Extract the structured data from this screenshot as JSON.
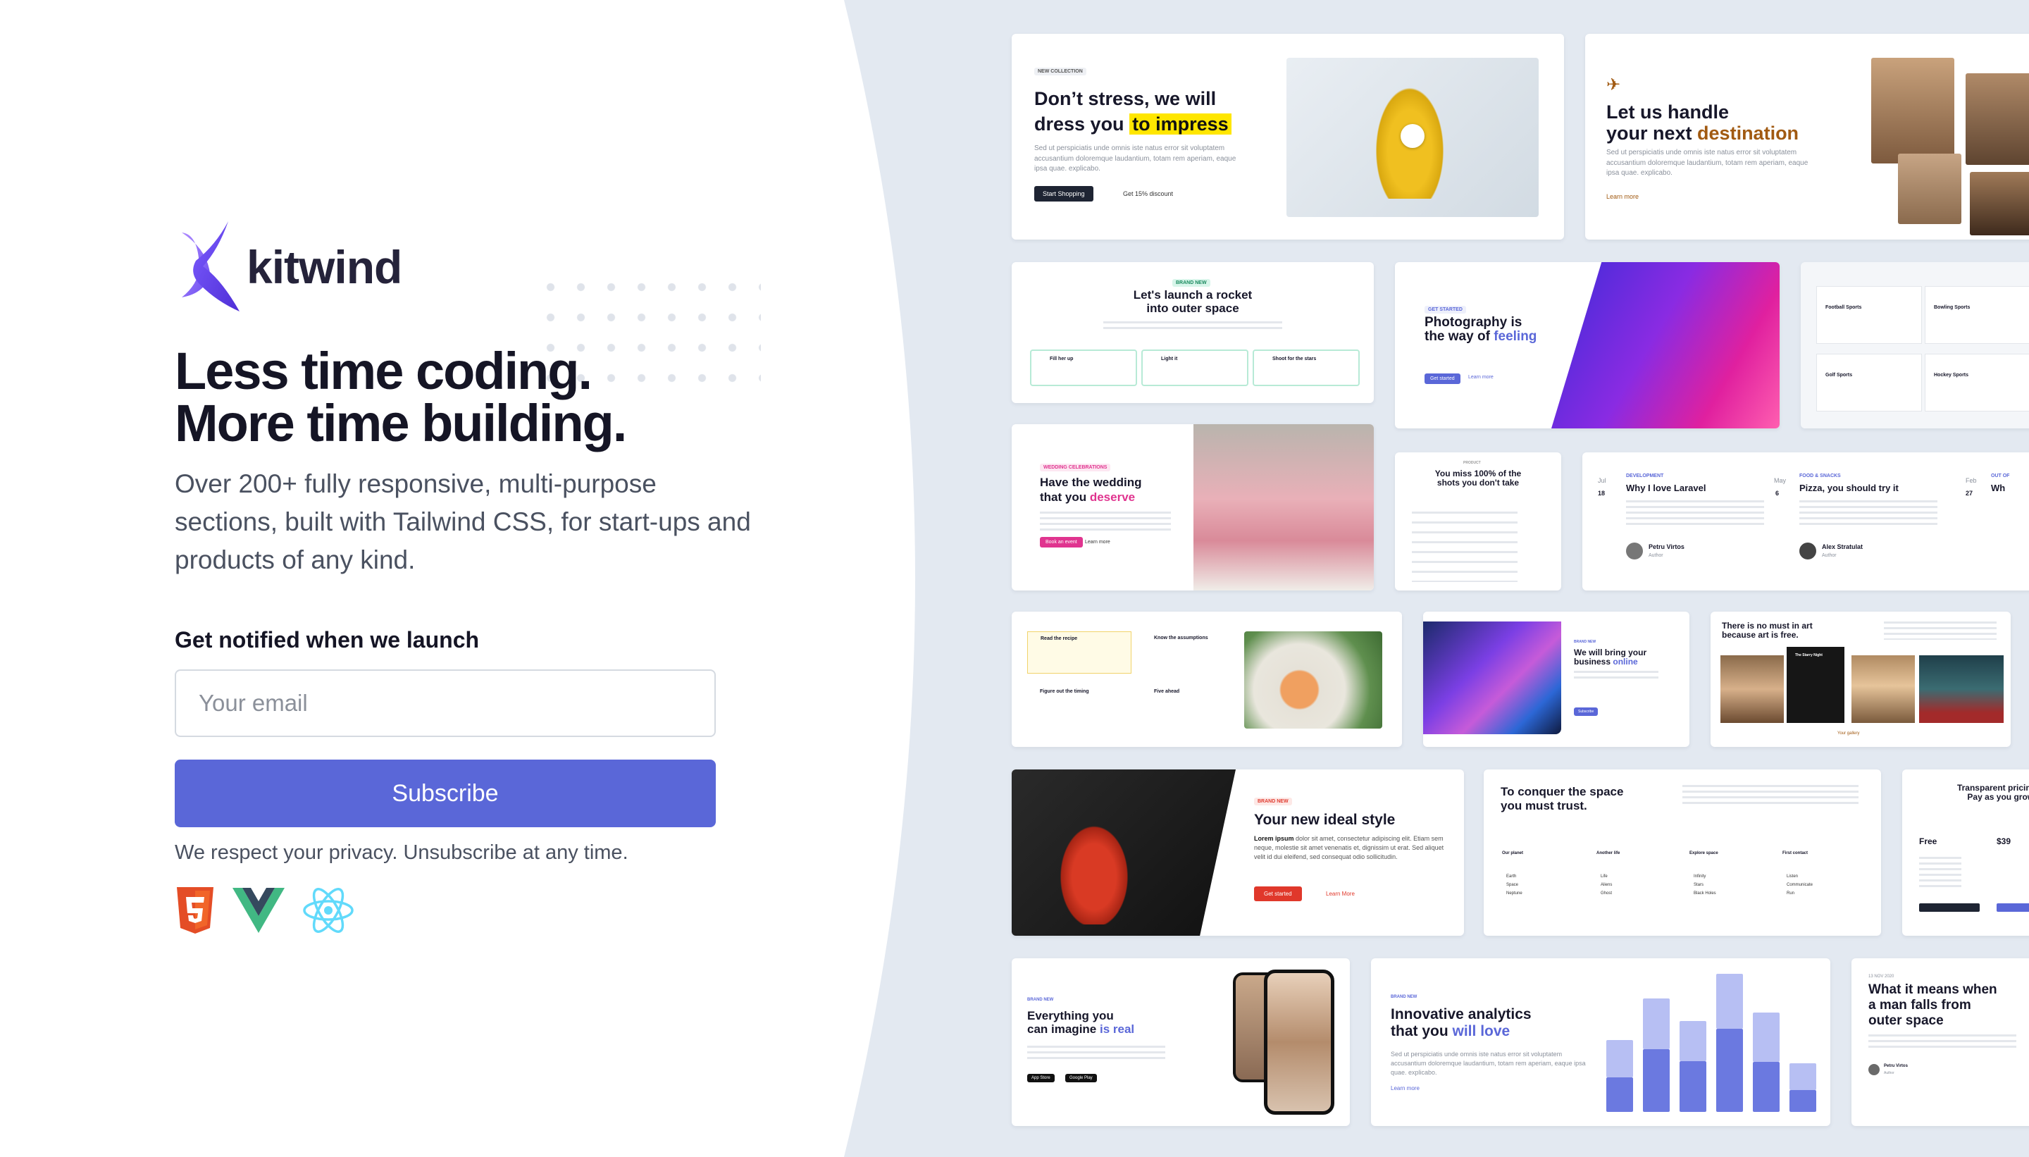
{
  "brand": {
    "name": "kitwind",
    "accent": "#5a67d8"
  },
  "hero": {
    "headline_line1": "Less time coding.",
    "headline_line2": "More time building.",
    "subtitle": "Over 200+ fully responsive, multi-purpose sections, built with Tailwind CSS, for start-ups and products of any kind."
  },
  "signup": {
    "label": "Get notified when we launch",
    "email_placeholder": "Your email",
    "button_label": "Subscribe",
    "privacy_note": "We respect your privacy. Unsubscribe at any time."
  },
  "tech_icons": [
    "html5-icon",
    "vue-icon",
    "react-icon"
  ],
  "gallery": {
    "fashion": {
      "tag": "NEW COLLECTION",
      "title_a": "Don’t stress, we will",
      "title_b": "dress you",
      "title_highlight": "to impress",
      "body": "Sed ut perspiciatis unde omnis iste natus error sit voluptatem accusantium doloremque laudantium, totam rem aperiam, eaque ipsa quae. explicabo.",
      "button": "Start Shopping",
      "link": "Get 15% discount"
    },
    "travel": {
      "title_a": "Let us handle",
      "title_b": "your next",
      "title_accent": "destination",
      "body": "Sed ut perspiciatis unde omnis iste natus error sit voluptatem accusantium doloremque laudantium, totam rem aperiam, eaque ipsa quae. explicabo.",
      "link": "Learn more"
    },
    "rocket": {
      "tag": "BRAND NEW",
      "title_a": "Let's launch a rocket",
      "title_b": "into outer space",
      "steps": [
        "Fill her up",
        "Light it",
        "Shoot for the stars"
      ]
    },
    "photo": {
      "tag": "GET STARTED",
      "title_a": "Photography is",
      "title_b": "the way of",
      "title_accent": "feeling",
      "button": "Get started",
      "link": "Learn more"
    },
    "sports": {
      "items": [
        "Football Sports",
        "Bowling Sports",
        "Golf Sports",
        "Hockey Sports"
      ]
    },
    "wedding": {
      "tag": "WEDDING CELEBRATIONS",
      "title_a": "Have the wedding",
      "title_b": "that you",
      "title_accent": "deserve",
      "button": "Book an event",
      "link": "Learn more"
    },
    "shots": {
      "tag": "PRODUCT",
      "title_a": "You miss 100% of the",
      "title_b": "shots you don't take"
    },
    "blog": [
      {
        "month": "Jul",
        "day": "18",
        "category": "DEVELOPMENT",
        "title": "Why I love Laravel",
        "author": "Petru Virtos",
        "role": "Author"
      },
      {
        "month": "May",
        "day": "6",
        "category": "FOOD & SNACKS",
        "title": "Pizza, you should try it",
        "author": "Alex Stratulat",
        "role": "Author"
      },
      {
        "month": "Feb",
        "day": "27",
        "category": "OUT OF",
        "title": "Wh"
      }
    ],
    "recipe": {
      "items": [
        "Read the recipe",
        "Know the assumptions",
        "Figure out the timing",
        "Five ahead"
      ]
    },
    "online": {
      "tag": "BRAND NEW",
      "title_a": "We will bring your",
      "title_b": "business",
      "title_accent": "online",
      "button": "Subscribe"
    },
    "art": {
      "title_a": "There is no must in art",
      "title_b": "because art is free.",
      "panel_caption": "The Starry Night",
      "link": "Your gallery"
    },
    "style": {
      "tag": "BRAND NEW",
      "title": "Your new ideal style",
      "body_lead": "Lorem ipsum",
      "body": "dolor sit amet, consectetur adipiscing elit. Etiam sem neque, molestie sit amet venenatis et, dignissim ut erat. Sed aliquet velit id dui eleifend, sed consequat odio sollicitudin.",
      "button": "Get started",
      "link": "Learn More"
    },
    "trust": {
      "title_a": "To conquer the space",
      "title_b": "you must trust.",
      "columns": [
        {
          "title": "Our planet",
          "items": [
            "Earth",
            "Space",
            "Neptune"
          ]
        },
        {
          "title": "Another life",
          "items": [
            "Life",
            "Aliens",
            "Ghost"
          ]
        },
        {
          "title": "Explore space",
          "items": [
            "Infinity",
            "Stars",
            "Black Holes"
          ]
        },
        {
          "title": "First contact",
          "items": [
            "Listen",
            "Communicate",
            "Run"
          ]
        }
      ],
      "link": "Learn more"
    },
    "pricing": {
      "title_a": "Transparent pricing",
      "title_b": "Pay as you grow.",
      "free_label": "Free",
      "price": "$39"
    },
    "app": {
      "tag": "BRAND NEW",
      "title_a": "Everything you",
      "title_b": "can imagine",
      "title_accent": "is real",
      "store_a": "App Store",
      "store_b": "Google Play"
    },
    "analytics": {
      "tag": "BRAND NEW",
      "title_a": "Innovative analytics",
      "title_b": "that you",
      "title_accent": "will love",
      "body": "Sed ut perspiciatis unde omnis iste natus error sit voluptatem accusantium doloremque laudantium, totam rem aperiam, eaque ipsa quae. explicabo.",
      "link": "Learn more",
      "bar_values": [
        0.52,
        0.82,
        0.66,
        1.0,
        0.72,
        0.35
      ],
      "bar_split": [
        0.48,
        0.55,
        0.56,
        0.6,
        0.5,
        0.45
      ]
    },
    "space": {
      "date": "13 NOV 2020",
      "title_a": "What it means when",
      "title_b": "a man falls from",
      "title_c": "outer space",
      "author": "Petru Virtos",
      "role": "Author"
    }
  }
}
